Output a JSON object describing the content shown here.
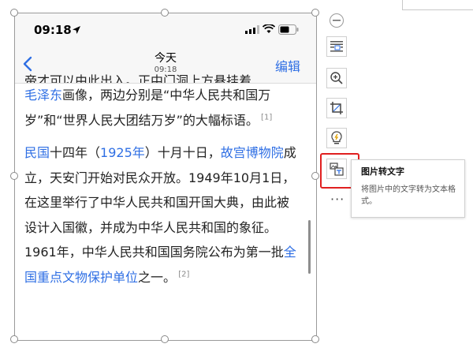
{
  "phone": {
    "time": "09:18",
    "nav": {
      "title": "今天",
      "subtitle": "09:18",
      "edit_label": "编辑"
    },
    "article": {
      "clipped_line": "帝才可以由此出入。正中门洞上方悬挂着",
      "p1": [
        {
          "text": "毛泽东",
          "link": true
        },
        {
          "text": "画像，两边分别是“中华人民共和国万岁”和“世界人民大团结万岁”的大幅标语。",
          "link": false
        }
      ],
      "p1_ref": "[1]",
      "p2": [
        {
          "text": "民国",
          "link": true
        },
        {
          "text": "十四年（",
          "link": false
        },
        {
          "text": "1925年",
          "link": true
        },
        {
          "text": "）十月十日，",
          "link": false
        },
        {
          "text": "故宫博物院",
          "link": true
        },
        {
          "text": "成立，天安门开始对民众开放。1949年10月1日，在这里举行了中华人民共和国开国大典，由此被设计入国徽，并成为中华人民共和国的象征。1961年，中华人民共和国国务院公布为第一批",
          "link": false
        },
        {
          "text": "全国重点文物保护单位",
          "link": true
        },
        {
          "text": "之一。",
          "link": false
        }
      ],
      "p2_ref": "[2]"
    }
  },
  "toolbar": {
    "items": [
      "collapse-icon",
      "layout-text-icon",
      "zoom-in-icon",
      "crop-icon",
      "lightbulb-icon",
      "image-to-text-icon",
      "more-icon"
    ],
    "more_label": "···"
  },
  "tooltip": {
    "title": "图片转文字",
    "description": "将图片中的文字转为文本格式。"
  },
  "colors": {
    "link": "#2f6fe4",
    "highlight": "#e02020",
    "edit": "#2f6fe4"
  }
}
